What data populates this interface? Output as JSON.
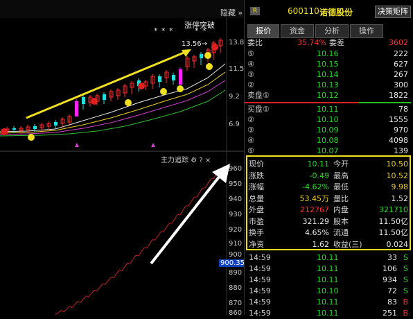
{
  "chart": {
    "toolbar_hide_label": "隐藏",
    "limit_up_label": "涨停突破",
    "stars_left": "* *   *",
    "stars_right": "*   *",
    "price_callout": "13.56→",
    "y_upper": [
      "13.8",
      "11.5",
      "9.2",
      "6.9"
    ],
    "indicator_title": "主力追踪",
    "y_lower": [
      "960",
      "950",
      "940",
      "930",
      "920",
      "910",
      "900",
      "890",
      "880",
      "870",
      "860"
    ],
    "current_value_badge": "900.35"
  },
  "panel": {
    "r_badge": "R",
    "stock_code": "600110",
    "stock_name": "诺德股份",
    "decision_button": "决策矩阵",
    "tabs": [
      "报价",
      "资金",
      "分析",
      "操作"
    ],
    "weibi": {
      "label": "委比",
      "pct": "35.74%",
      "label2": "委差",
      "value": "3602"
    },
    "sell_orders": [
      {
        "level": "⑤",
        "price": "10.16",
        "volume": "222"
      },
      {
        "level": "④",
        "price": "10.15",
        "volume": "627"
      },
      {
        "level": "③",
        "price": "10.14",
        "volume": "267"
      },
      {
        "level": "②",
        "price": "10.13",
        "volume": "300"
      },
      {
        "level": "卖盘①",
        "price": "10.12",
        "volume": "1822"
      }
    ],
    "buy_orders": [
      {
        "level": "买盘①",
        "price": "10.11",
        "volume": "78"
      },
      {
        "level": "②",
        "price": "10.10",
        "volume": "1555"
      },
      {
        "level": "③",
        "price": "10.09",
        "volume": "970"
      },
      {
        "level": "④",
        "price": "10.08",
        "volume": "4098"
      },
      {
        "level": "⑤",
        "price": "10.07",
        "volume": "139"
      }
    ],
    "stats": [
      {
        "l1": "现价",
        "v1": "10.11",
        "l2": "今开",
        "v2": "10.50"
      },
      {
        "l1": "涨跌",
        "v1": "-0.49",
        "l2": "最高",
        "v2": "10.52"
      },
      {
        "l1": "涨幅",
        "v1": "-4.62%",
        "l2": "最低",
        "v2": "9.98"
      },
      {
        "l1": "总量",
        "v1": "53.45万",
        "l2": "量比",
        "v2": "1.52"
      },
      {
        "l1": "外盘",
        "v1": "212767",
        "l2": "内盘",
        "v2": "321710"
      },
      {
        "l1": "市盈",
        "v1": "321.29",
        "l2": "股本",
        "v2": "11.50亿"
      },
      {
        "l1": "换手",
        "v1": "4.65%",
        "l2": "流通",
        "v2": "11.50亿"
      },
      {
        "l1": "净资",
        "v1": "1.62",
        "l2": "收益(三)",
        "v2": "0.024"
      }
    ],
    "ticks": [
      {
        "time": "14:59",
        "price": "10.11",
        "vol": "33",
        "side": "S"
      },
      {
        "time": "14:59",
        "price": "10.11",
        "vol": "106",
        "side": "S"
      },
      {
        "time": "14:59",
        "price": "10.11",
        "vol": "934",
        "side": "S"
      },
      {
        "time": "14:59",
        "price": "10.10",
        "vol": "72",
        "side": "S"
      },
      {
        "time": "14:59",
        "price": "10.11",
        "vol": "83",
        "side": "B"
      },
      {
        "time": "14:59",
        "price": "10.11",
        "vol": "251",
        "side": "B"
      }
    ]
  },
  "colors": {
    "up": "#ff3030",
    "down": "#20e020",
    "accent": "#f0e020",
    "bg": "#000000"
  }
}
